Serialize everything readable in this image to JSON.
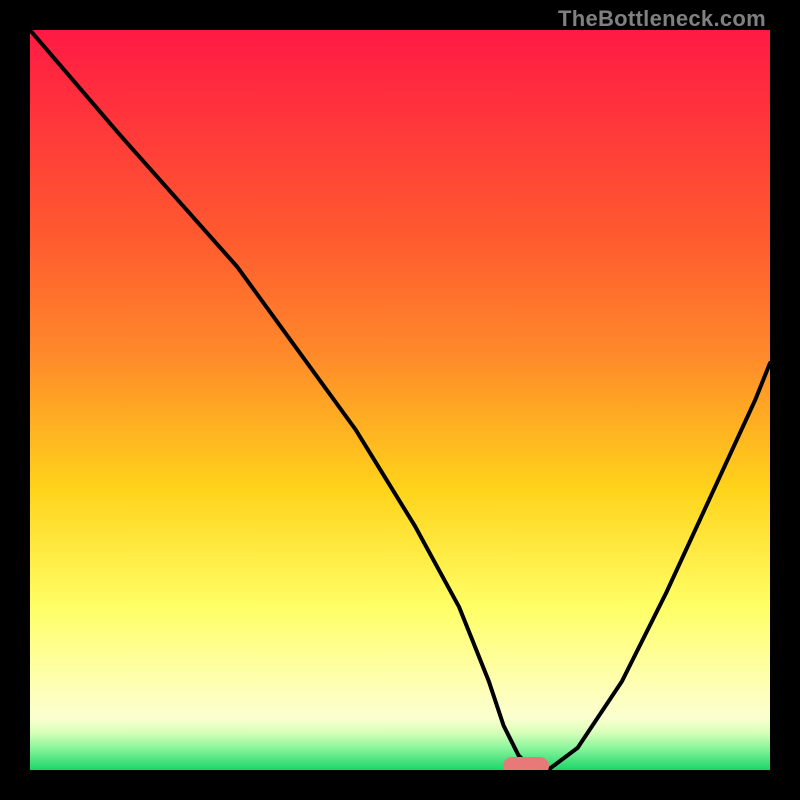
{
  "watermark": "TheBottleneck.com",
  "colors": {
    "top": "#ff1a44",
    "upper_mid": "#ff8a2a",
    "mid": "#ffd31a",
    "lower_mid": "#ffff66",
    "pale_band": "#ffffb0",
    "green": "#1ad66a",
    "curve": "#000000",
    "frame": "#000000",
    "marker": "#e77a78"
  },
  "chart_data": {
    "type": "line",
    "title": "",
    "xlabel": "",
    "ylabel": "",
    "xlim": [
      0,
      100
    ],
    "ylim": [
      0,
      100
    ],
    "series": [
      {
        "name": "bottleneck-curve",
        "x": [
          0,
          6,
          12,
          20,
          28,
          36,
          44,
          52,
          58,
          62,
          64,
          66,
          68,
          70,
          74,
          80,
          86,
          92,
          98,
          100
        ],
        "values": [
          100,
          93,
          86,
          77,
          68,
          57,
          46,
          33,
          22,
          12,
          6,
          2,
          0,
          0,
          3,
          12,
          24,
          37,
          50,
          55
        ]
      }
    ],
    "annotations": [
      {
        "name": "optimal-marker",
        "x": 67,
        "y": 0.6
      }
    ],
    "gradient_bands_pct_from_top": {
      "red_start": 0,
      "orange_mid": 40,
      "yellow_mid": 62,
      "pale_yellow": 80,
      "cream": 90,
      "green_end": 100
    }
  }
}
